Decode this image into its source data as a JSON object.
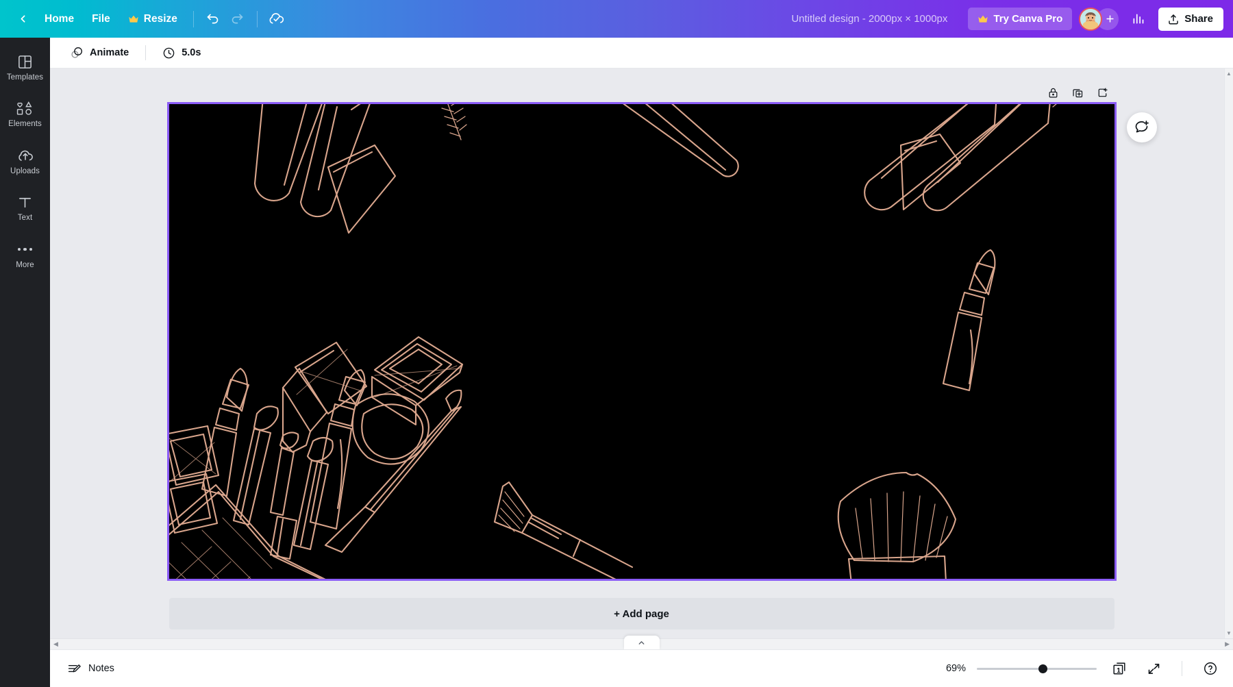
{
  "topbar": {
    "back_icon": "chevron-left-icon",
    "home_label": "Home",
    "file_label": "File",
    "resize_label": "Resize",
    "resize_crown_icon": "crown-icon",
    "undo_icon": "undo-icon",
    "redo_icon": "redo-icon",
    "cloud_saved_icon": "cloud-check-icon",
    "design_title": "Untitled design - 2000px × 1000px",
    "pro_label": "Try Canva Pro",
    "pro_crown_icon": "crown-icon",
    "avatar_name": "user-avatar",
    "add_person_icon": "plus-icon",
    "stats_icon": "bar-chart-icon",
    "share_label": "Share",
    "share_icon": "upload-icon",
    "gradient_start": "#00c4cc",
    "gradient_mid": "#4a6ee0",
    "gradient_end": "#7d2ae8"
  },
  "sidebar": {
    "items": [
      {
        "label": "Templates",
        "icon": "templates-icon"
      },
      {
        "label": "Elements",
        "icon": "elements-icon"
      },
      {
        "label": "Uploads",
        "icon": "uploads-cloud-icon"
      },
      {
        "label": "Text",
        "icon": "text-icon"
      },
      {
        "label": "More",
        "icon": "more-dots-icon"
      }
    ]
  },
  "subbar": {
    "animate_label": "Animate",
    "animate_icon": "animate-circles-icon",
    "duration_label": "5.0s",
    "duration_icon": "clock-icon"
  },
  "page_tools": {
    "lock_icon": "lock-icon",
    "duplicate_icon": "duplicate-page-icon",
    "add_page_icon": "add-page-icon"
  },
  "canvas": {
    "comment_icon": "add-comment-icon",
    "background_color": "#000000",
    "selection_color": "#8b5cf6",
    "artwork_color": "#d9a58c",
    "artwork_description": "rose-gold line-art makeup illustrations",
    "artwork_items": [
      "mascara-tube-top-left",
      "mascara-wand-top-left",
      "lipgloss-applicator-top-center",
      "mascara-tube-top-right",
      "lipgloss-wand-top-right",
      "lipstick-right",
      "makeup-bag-bottom-left",
      "lipstick-bag-bottom-left",
      "eyeshadow-brush-bottom-left",
      "mascara-bottom-left",
      "compact-powder-bottom-left",
      "eyebrow-pencil-bottom-left",
      "foundation-tube-bottom-left",
      "angled-brush-bottom-center",
      "kabuki-brush-bottom-right"
    ]
  },
  "add_page": {
    "label": "+ Add page"
  },
  "bottombar": {
    "notes_label": "Notes",
    "notes_icon": "notes-pencil-icon",
    "zoom_percent": "69%",
    "zoom_slider_value": 55,
    "page_count_label": "1",
    "page_count_icon": "pages-icon",
    "fullscreen_icon": "expand-arrows-icon",
    "help_icon": "help-question-icon"
  },
  "scrollbars": {
    "left_arrow": "◀",
    "right_arrow": "▶",
    "up_arrow": "▲",
    "down_arrow": "▼",
    "collapse_icon": "chevron-up-icon"
  }
}
